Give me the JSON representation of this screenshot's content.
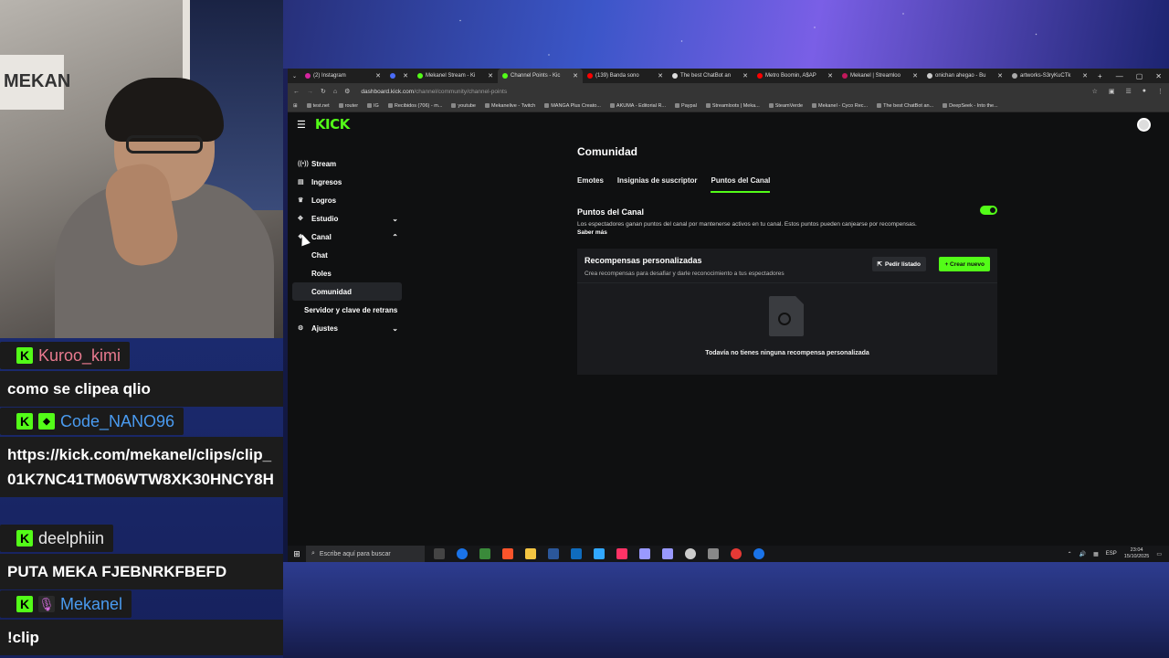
{
  "chat": {
    "messages": [
      {
        "user": "Kuroo_kimi",
        "color": "#e87a8f",
        "text": "como se clipea qlio",
        "badges": [
          "kick"
        ]
      },
      {
        "user": "Code_NANO96",
        "color": "#4a9bf0",
        "text": "https://kick.com/mekanel/clips/clip_01K7NC41TM06WTW8XK30HNCY8H",
        "badges": [
          "kick",
          "extra"
        ]
      },
      {
        "user": "deelphiin",
        "color": "#e9e9e9",
        "text": "PUTA MEKA FJEBNRKFBEFD",
        "badges": [
          "kick"
        ]
      },
      {
        "user": "Mekanel",
        "color": "#4a9bf0",
        "text": "!clip",
        "badges": [
          "kick",
          "mic"
        ]
      }
    ]
  },
  "webcam": {
    "poster_text": "MEKAN"
  },
  "browser": {
    "tabs": [
      {
        "label": "(2) Instagram",
        "active": false
      },
      {
        "label": "",
        "active": false
      },
      {
        "label": "Mekanel Stream - Ki",
        "active": false
      },
      {
        "label": "Channel Points - Kic",
        "active": true
      },
      {
        "label": "(139) Banda sono",
        "active": false
      },
      {
        "label": "The best ChatBot an",
        "active": false
      },
      {
        "label": "Metro Boomin, A$AP",
        "active": false
      },
      {
        "label": "Mekanel | Streamloo",
        "active": false
      },
      {
        "label": "onichan ahegao - Bu",
        "active": false
      },
      {
        "label": "artworks-S3ryKuCTk",
        "active": false
      }
    ],
    "url_host": "dashboard.kick.com",
    "url_path": "/channel/community/channel-points",
    "bookmarks": [
      "test.net",
      "router",
      "IG",
      "Recibidos (706) - m...",
      "youtube",
      "Mekanelive - Twitch",
      "MANGA Plus Creato...",
      "AKUMA - Editorial R...",
      "Paypal",
      "Streamloots | Meka...",
      "SteamVerde",
      "Mekanel - Cyco Rec...",
      "The best ChatBot an...",
      "DeepSeek - Into the..."
    ]
  },
  "kick": {
    "logo": "KICK",
    "sidebar": {
      "items": [
        {
          "label": "Stream",
          "icon": "stream-icon"
        },
        {
          "label": "Ingresos",
          "icon": "revenue-icon"
        },
        {
          "label": "Logros",
          "icon": "trophy-icon"
        },
        {
          "label": "Estudio",
          "icon": "studio-icon"
        },
        {
          "label": "Canal",
          "icon": "channel-icon"
        }
      ],
      "canal_sub": [
        "Chat",
        "Roles",
        "Comunidad"
      ],
      "server_key": "Servidor y clave de retrans",
      "settings": "Ajustes"
    },
    "page_title": "Comunidad",
    "tabs": [
      "Emotes",
      "Insignias de suscriptor",
      "Puntos del Canal"
    ],
    "active_tab": "Puntos del Canal",
    "points": {
      "title": "Puntos del Canal",
      "enabled": true,
      "description": "Los espectadores ganan puntos del canal por mantenerse activos en tu canal. Estos puntos pueden canjearse por recompensas.",
      "learn_more": "Saber más"
    },
    "rewards": {
      "title": "Recompensas personalizadas",
      "subtitle": "Crea recompensas para desafiar y darle reconocimiento a tus espectadores",
      "request_button": "Pedir listado",
      "create_button": "+ Crear nuevo",
      "empty_text": "Todavía no tienes ninguna recompensa personalizada"
    }
  },
  "taskbar": {
    "search_placeholder": "Escribe aquí para buscar",
    "lang": "ESP",
    "time": "23:04",
    "date": "15/10/2025"
  }
}
